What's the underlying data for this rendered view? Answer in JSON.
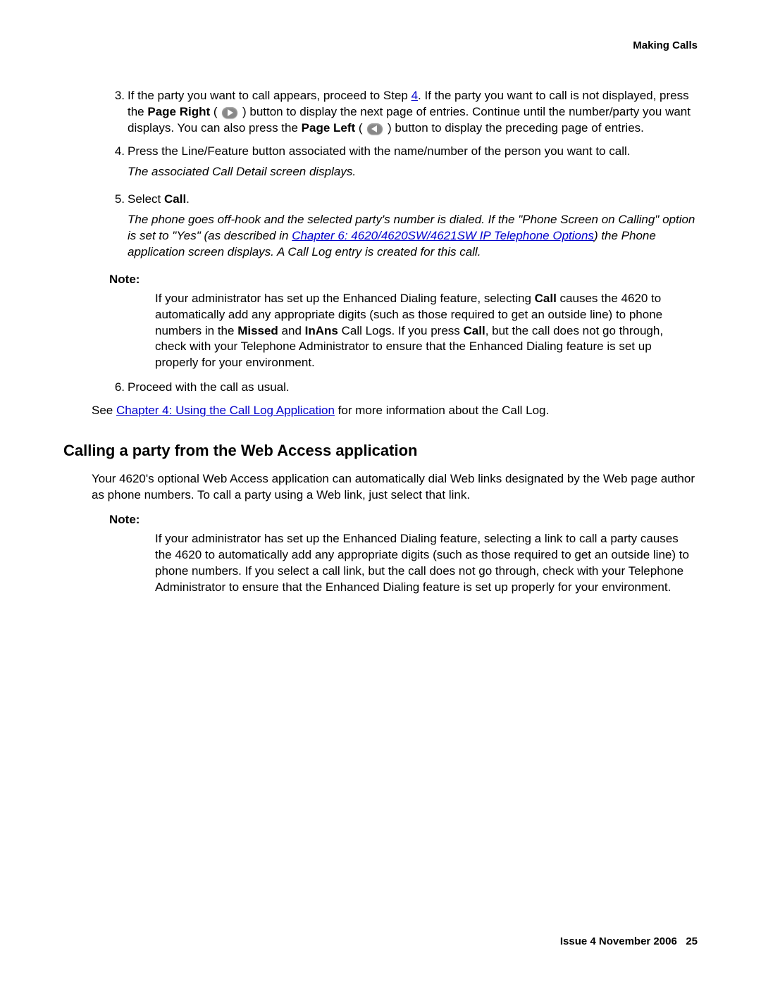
{
  "header": {
    "title": "Making Calls"
  },
  "steps": {
    "s3": {
      "num": "3.",
      "t1": "If the party you want to call appears, proceed to Step ",
      "link4": "4",
      "t2": ". If the party you want to call is not displayed, press the ",
      "pageRight": "Page Right",
      "t3": " ( ",
      "t4": " ) button to display the next page of entries. Continue until the number/party you want displays. You can also press the ",
      "pageLeft": "Page Left",
      "t5": " ( ",
      "t6": " ) button to display the preceding page of entries."
    },
    "s4": {
      "num": "4.",
      "text": "Press the Line/Feature button associated with the name/number of the person you want to call.",
      "result": "The associated Call Detail screen displays."
    },
    "s5": {
      "num": "5.",
      "t1": "Select ",
      "call": "Call",
      "t2": ".",
      "res1": "The phone goes off-hook and the selected party's number is dialed. If the \"Phone Screen on Calling\" option is set to \"Yes\" (as described in ",
      "resLink": "Chapter 6: 4620/4620SW/4621SW IP Telephone Options",
      "res2": ") the Phone application screen displays. A Call Log entry is created for this call."
    },
    "s6": {
      "num": "6.",
      "text": "Proceed with the call as usual."
    }
  },
  "note1": {
    "label": "Note:",
    "t1": "If your administrator has set up the Enhanced Dialing feature, selecting ",
    "call1": "Call",
    "t2": " causes the 4620 to automatically add any appropriate digits (such as those required to get an outside line) to phone numbers in the ",
    "missed": "Missed",
    "t3": " and ",
    "inans": "InAns",
    "t4": " Call Logs. If you press ",
    "call2": "Call",
    "t5": ", but the call does not go through, check with your Telephone Administrator to ensure that the Enhanced Dialing feature is set up properly for your environment."
  },
  "see": {
    "t1": "See ",
    "link": "Chapter 4: Using the Call Log Application",
    "t2": " for more information about the Call Log."
  },
  "section": {
    "heading": "Calling a party from the Web Access application",
    "para": "Your 4620's optional Web Access application can automatically dial Web links designated by the Web page author as phone numbers. To call a party using a Web link, just select that link."
  },
  "note2": {
    "label": "Note:",
    "text": "If your administrator has set up the Enhanced Dialing feature, selecting a link to call a party causes the 4620 to automatically add any appropriate digits (such as those required to get an outside line) to phone numbers. If you select a call link, but the call does not go through, check with your Telephone Administrator to ensure that the Enhanced Dialing feature is set up properly for your environment."
  },
  "footer": {
    "issue": "Issue 4   November 2006",
    "page": "25"
  }
}
